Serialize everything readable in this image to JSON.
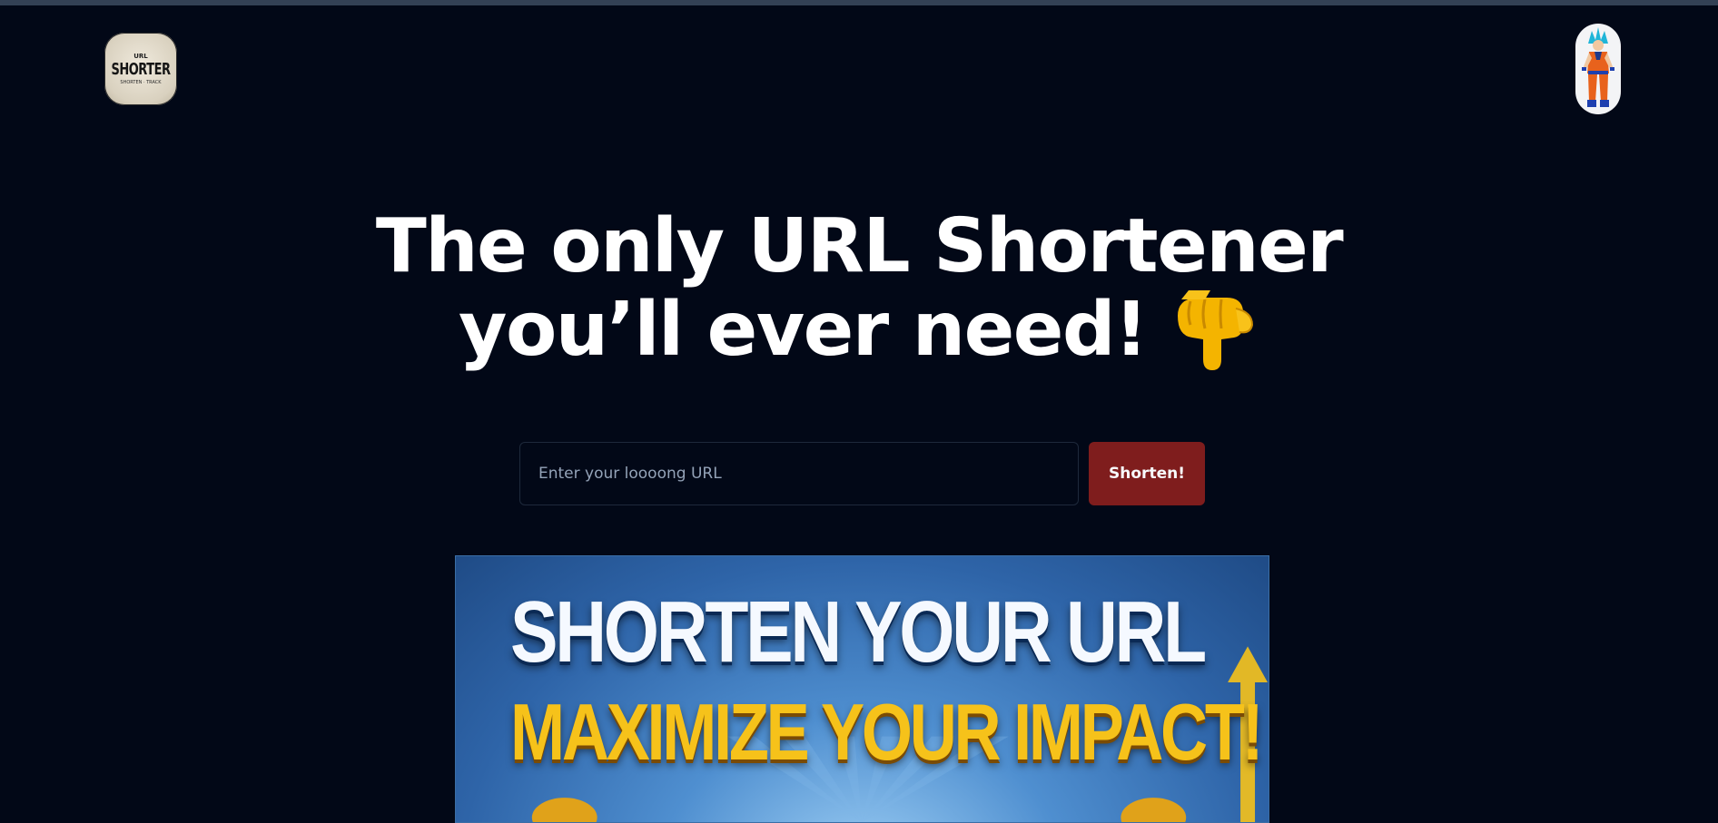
{
  "header": {
    "logo": {
      "icon": "scissors-logo",
      "text_top": "URL",
      "text_main": "SHORTER",
      "text_bottom": "SHORTEN · TRACK"
    },
    "avatar": {
      "icon": "user-avatar"
    }
  },
  "hero": {
    "headline_line1": "The only URL Shortener",
    "headline_line2": "you’ll ever need!",
    "emoji": "pointing-down-icon"
  },
  "form": {
    "url_input_value": "",
    "url_input_placeholder": "Enter your loooong URL",
    "submit_label": "Shorten!"
  },
  "banner": {
    "line1": "SHORTEN YOUR URL",
    "line2": "MAXIMIZE YOUR IMPACT!"
  },
  "colors": {
    "background": "#020817",
    "button": "#7f1d1d",
    "banner_yellow": "#f6c21a"
  }
}
